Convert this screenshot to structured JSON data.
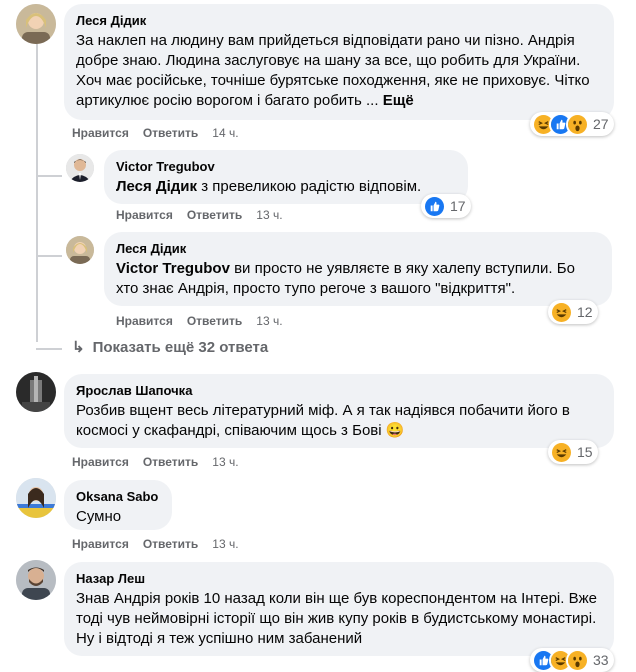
{
  "actions": {
    "like": "Нравится",
    "reply": "Ответить"
  },
  "comments": [
    {
      "author": "Леся Дідик",
      "text": "За наклеп на людину вам прийдеться відповідати рано чи пізно. Андрія добре знаю. Людина заслуговує на шану за все, що робить для України. Хоч має російське, точніше бурятське походження, яке не приховує. Чітко артикулює росію ворогом і багато робить ...",
      "more": "Ещё",
      "time": "14 ч.",
      "reaction_count": "27",
      "reactions": [
        "haha",
        "like",
        "wow"
      ]
    },
    {
      "author": "Victor Tregubov",
      "mention": "Леся Дідик",
      "text": " з превеликою радістю відповім.",
      "time": "13 ч.",
      "reaction_count": "17",
      "reactions": [
        "like"
      ]
    },
    {
      "author": "Леся Дідик",
      "mention": "Victor Tregubov",
      "text": " ви просто не уявляєте в яку халепу вступили. Бо хто знає Андрія, просто тупо регоче з вашого \"відкриття\".",
      "time": "13 ч.",
      "reaction_count": "12",
      "reactions": [
        "haha"
      ]
    },
    {
      "author": "Ярослав Шапочка",
      "text": "Розбив вщент весь літературний міф. А я так надіявся побачити його в космосі у скафандрі, співаючим щось з Бові 😀",
      "time": "13 ч.",
      "reaction_count": "15",
      "reactions": [
        "haha"
      ]
    },
    {
      "author": "Oksana Sabo",
      "text": "Сумно",
      "time": "13 ч."
    },
    {
      "author": "Назар Леш",
      "text": "Знав Андрія років 10 назад коли він ще був кореспондентом на Інтері. Вже тоді чув неймовірні історії що він жив купу років в будистському монастирі. Ну і відтоді я теж успішно ним забанений",
      "time": "13 ч.",
      "reaction_count": "33",
      "reactions": [
        "like",
        "haha",
        "wow"
      ]
    }
  ],
  "show_more_replies": "Показать ещё 32 ответа",
  "colors": {
    "bubble": "#f0f2f5",
    "meta": "#65676b",
    "like": "#1877f2",
    "haha": "#f7b125"
  }
}
